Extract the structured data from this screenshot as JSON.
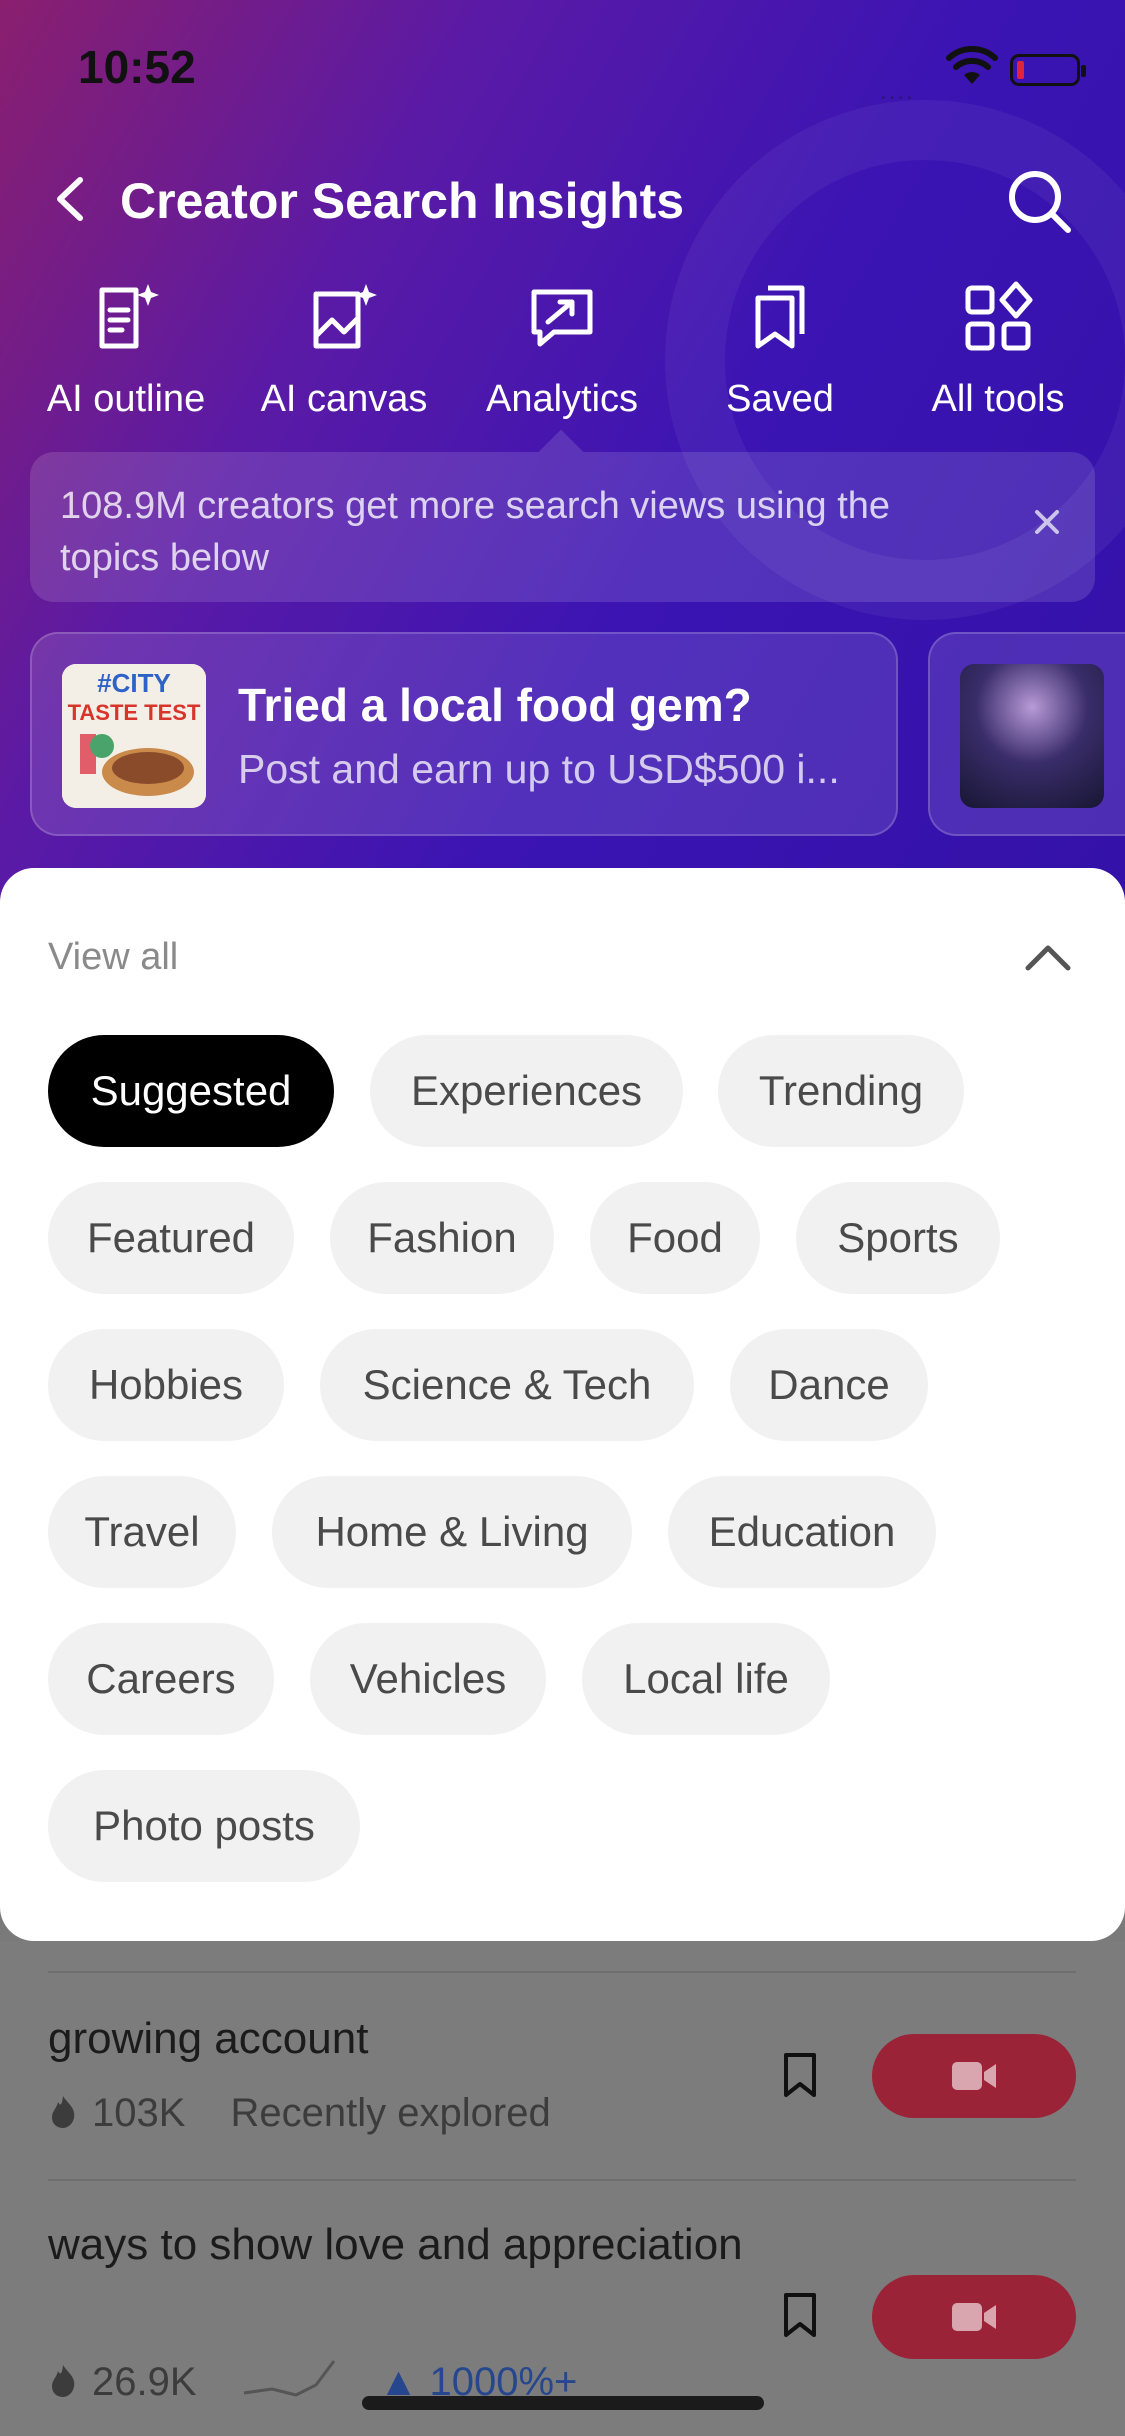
{
  "status_bar": {
    "time": "10:52",
    "signal": "....",
    "battery_color": "#e0243a"
  },
  "header": {
    "title": "Creator Search Insights",
    "tools": [
      {
        "label": "AI outline",
        "icon": "document-sparkle-icon"
      },
      {
        "label": "AI canvas",
        "icon": "image-sparkle-icon"
      },
      {
        "label": "Analytics",
        "icon": "chart-bubble-icon"
      },
      {
        "label": "Saved",
        "icon": "bookmark-stack-icon"
      },
      {
        "label": "All tools",
        "icon": "grid-icon"
      }
    ],
    "notice": "108.9M creators get more search views using the topics below"
  },
  "promo": {
    "title": "Tried a local food gem?",
    "subtitle": "Post and earn up to USD$500 i...",
    "thumb_text_top": "#CITY",
    "thumb_text_bottom": "TASTE TEST"
  },
  "sheet": {
    "view_all": "View all",
    "chips": [
      "Suggested",
      "Experiences",
      "Trending",
      "Featured",
      "Fashion",
      "Food",
      "Sports",
      "Hobbies",
      "Science & Tech",
      "Dance",
      "Travel",
      "Home & Living",
      "Education",
      "Careers",
      "Vehicles",
      "Local life",
      "Photo posts"
    ],
    "active_chip": "Suggested"
  },
  "list": [
    {
      "title": "growing account",
      "count": "103K",
      "note": "Recently explored"
    },
    {
      "title": "ways to show love and appreciation",
      "count": "26.9K",
      "trend": "1000%+"
    }
  ],
  "colors": {
    "accent_red": "#9b2337",
    "gradient_start": "#8a1f6e",
    "gradient_end": "#3411a8"
  }
}
